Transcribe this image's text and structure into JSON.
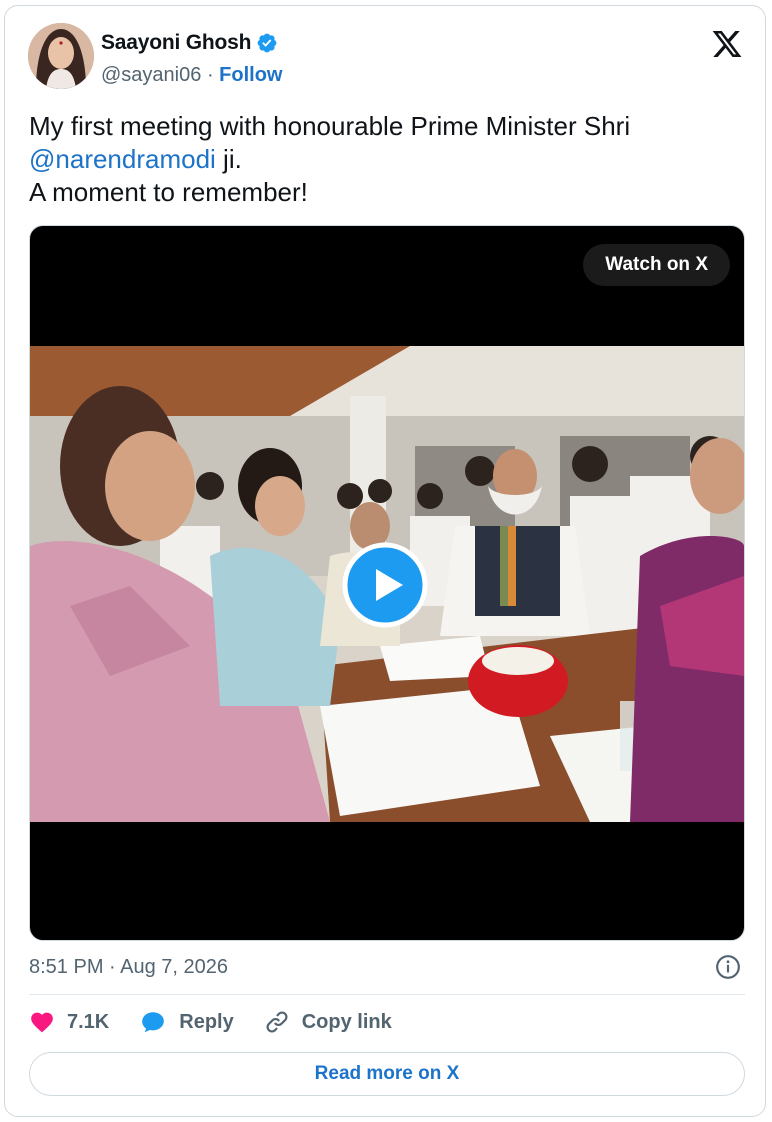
{
  "author": {
    "name": "Saayoni Ghosh",
    "handle": "@sayani06",
    "separator": "·",
    "follow_label": "Follow"
  },
  "tweet": {
    "text_line1": "My first meeting with honourable Prime Minister Shri",
    "mention": "@narendramodi",
    "text_after_mention": " ji.",
    "text_line3": "A moment to remember!"
  },
  "media": {
    "watch_label": "Watch on X"
  },
  "meta": {
    "timestamp": "8:51 PM · Aug 7, 2026"
  },
  "actions": {
    "likes": "7.1K",
    "reply_label": "Reply",
    "copy_link_label": "Copy link"
  },
  "footer": {
    "read_more_label": "Read more on X"
  },
  "colors": {
    "accent": "#1d73c9",
    "like": "#f91880",
    "reply": "#1d9bf0",
    "muted": "#536471"
  }
}
